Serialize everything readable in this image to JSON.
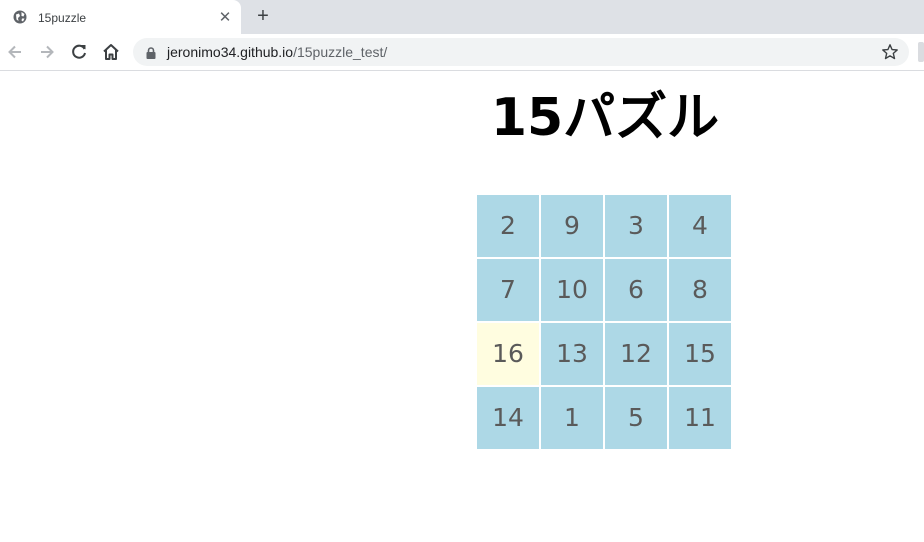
{
  "browser": {
    "tab_title": "15puzzle",
    "url_host": "jeronimo34.github.io",
    "url_path": "/15puzzle_test/"
  },
  "page": {
    "title": "15パズル"
  },
  "puzzle": {
    "tiles": [
      2,
      9,
      3,
      4,
      7,
      10,
      6,
      8,
      16,
      13,
      12,
      15,
      14,
      1,
      5,
      11
    ],
    "empty_value": 16,
    "tile_color": "#add8e6",
    "empty_color": "#fffde0"
  }
}
